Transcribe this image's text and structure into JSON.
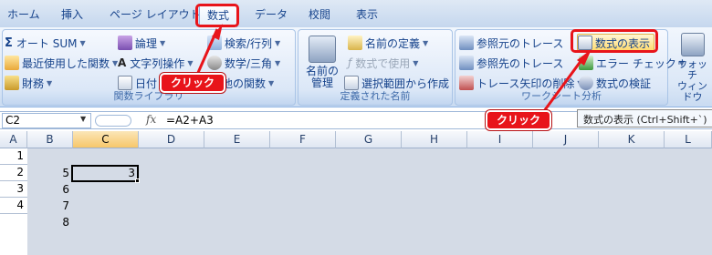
{
  "tabs": [
    "ホーム",
    "挿入",
    "ページ レイアウト",
    "数式",
    "データ",
    "校閲",
    "表示"
  ],
  "ribbon": {
    "group1": {
      "label": "関数ライブラリ",
      "autosum": "オート SUM",
      "recent": "最近使用した関数",
      "financial": "財務",
      "logical": "論理",
      "text": "文字列操作",
      "date": "日付",
      "lookup": "検索/行列",
      "math": "数学/三角",
      "more": "他の関数"
    },
    "group2": {
      "label": "定義された名前",
      "name_manager_1": "名前の",
      "name_manager_2": "管理",
      "define_name": "名前の定義",
      "use_in_formula": "数式で使用",
      "create_from_selection": "選択範囲から作成"
    },
    "group3": {
      "label": "ワークシート分析",
      "trace_precedents": "参照元のトレース",
      "trace_dependents": "参照先のトレース",
      "remove_arrows": "トレース矢印の削除",
      "show_formulas": "数式の表示",
      "error_checking": "エラー チェック",
      "evaluate_formula": "数式の検証",
      "watch_1": "ウォッチ",
      "watch_2": "ウィンドウ"
    }
  },
  "callouts": [
    "クリック",
    "クリック"
  ],
  "tooltip": "数式の表示 (Ctrl+Shift+`)",
  "formula_bar": {
    "name_box": "C2",
    "fx": "fx",
    "formula": "=A2+A3"
  },
  "columns": [
    "A",
    "B",
    "C",
    "D",
    "E",
    "F",
    "G",
    "H",
    "I",
    "J",
    "K",
    "L"
  ],
  "rows": [
    "1",
    "2",
    "3",
    "4"
  ],
  "cells": {
    "B1": "5",
    "B2": "6",
    "B3": "7",
    "B4": "8",
    "C1": "3"
  }
}
